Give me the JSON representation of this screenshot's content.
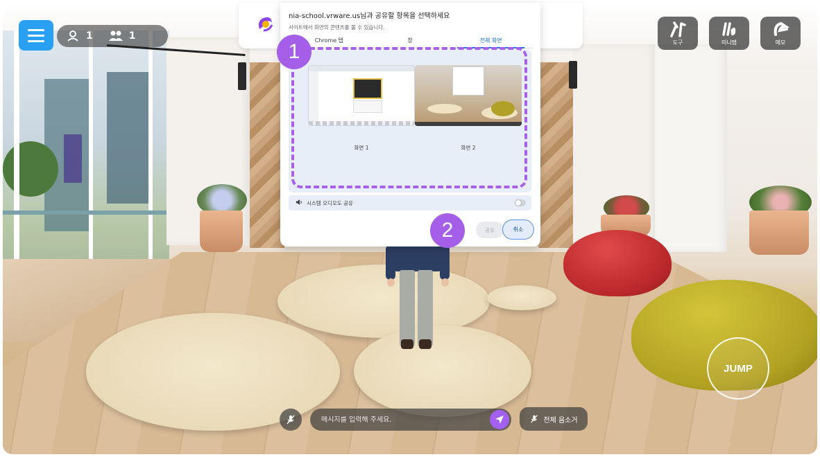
{
  "hud": {
    "user_counts": [
      {
        "icon": "user-icon",
        "value": "1"
      },
      {
        "icon": "users-icon",
        "value": "1"
      }
    ],
    "tools": [
      {
        "icon": "tools-icon",
        "label": "도구"
      },
      {
        "icon": "minimap-icon",
        "label": "미니맵"
      },
      {
        "icon": "memo-icon",
        "label": "메모"
      }
    ],
    "jump_label": "JUMP",
    "chat_placeholder": "메시지를 입력해 주세요.",
    "mute_all_label": "전체 음소거"
  },
  "share_dialog": {
    "title": "nia-school.vrware.us님과 공유할 항목을 선택하세요",
    "subtitle": "사이트에서 화면의 콘텐츠를 볼 수 있습니다.",
    "tabs": [
      {
        "label": "Chrome 탭",
        "active": false
      },
      {
        "label": "창",
        "active": false
      },
      {
        "label": "전체 화면",
        "active": true
      }
    ],
    "screens": [
      {
        "label": "화면 1"
      },
      {
        "label": "화면 2"
      }
    ],
    "audio_label": "시스템 오디오도 공유",
    "share_label": "공유",
    "cancel_label": "취소"
  },
  "annotations": {
    "step1": "1",
    "step2": "2"
  },
  "colors": {
    "accent_purple": "#a45ee8",
    "menu_blue": "#2aa0f2",
    "chrome_blue": "#1a73e8"
  }
}
